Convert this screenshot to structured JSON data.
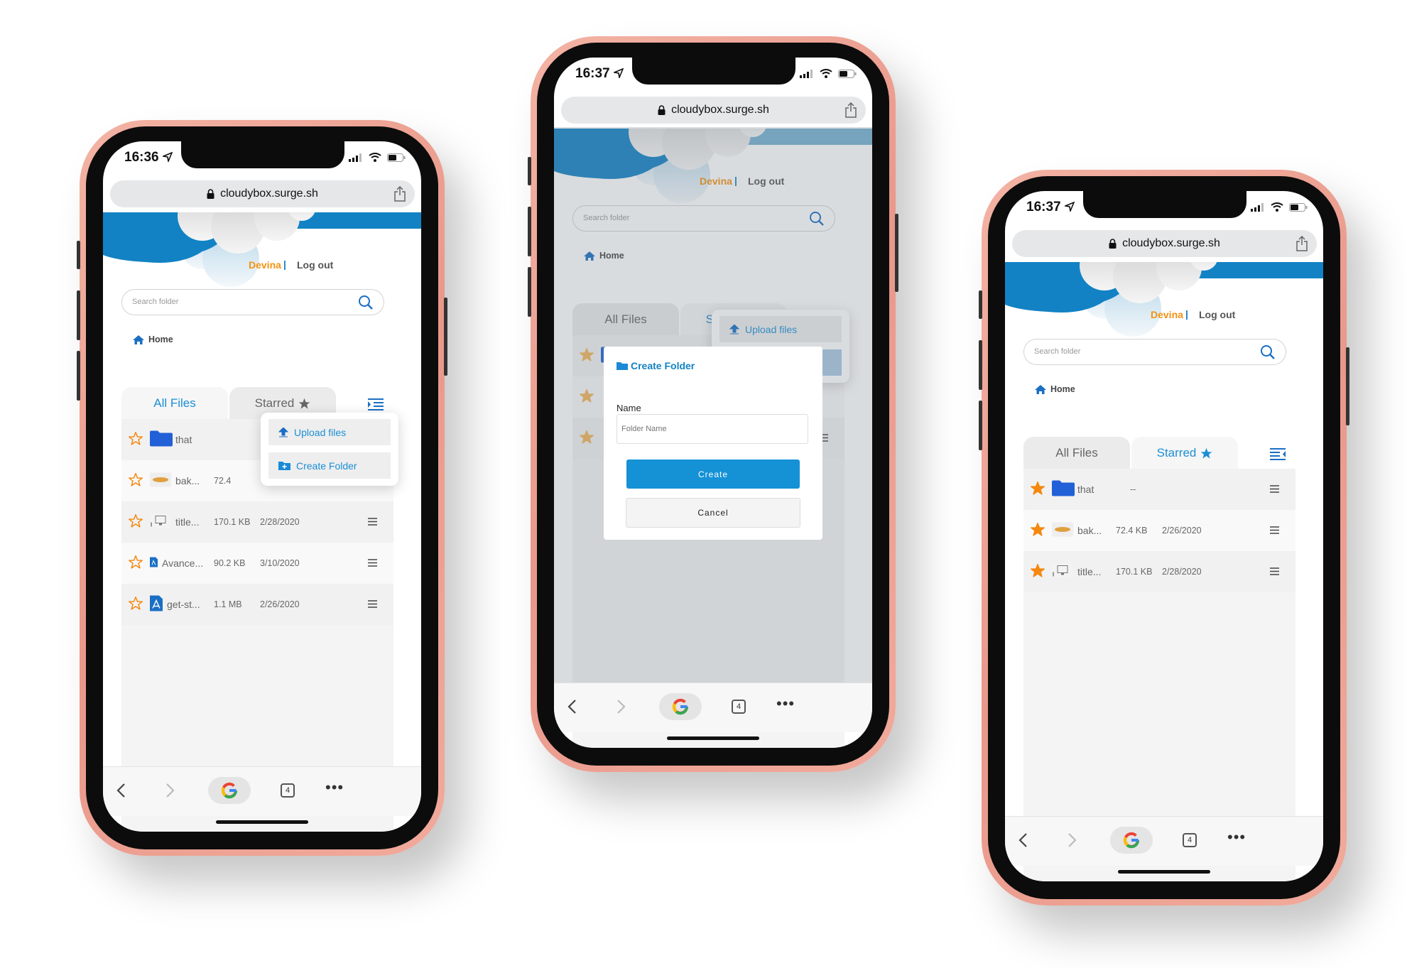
{
  "colors": {
    "brand_blue": "#1282c4",
    "accent_orange": "#f39212",
    "tab_active": "#1b8fd6",
    "folder": "#2160d6",
    "phone_rim": "#ee9f91"
  },
  "phones": [
    {
      "status_time": "16:36",
      "url": "cloudybox.surge.sh",
      "user": "Devina",
      "separator": "|",
      "logout": "Log out",
      "search_placeholder": "Search folder",
      "breadcrumb": "Home",
      "tabs": [
        {
          "label": "All Files",
          "active": true,
          "icon": "star-icon"
        },
        {
          "label": "Starred",
          "active": false,
          "icon": "star-icon"
        }
      ],
      "rows": [
        {
          "starred": false,
          "icon": "folder-icon",
          "name": "that",
          "size": "",
          "date": ""
        },
        {
          "starred": false,
          "icon": "image-thumbnail",
          "name": "bak...",
          "size": "72.4",
          "date": ""
        },
        {
          "starred": false,
          "icon": "computer-thumbnail",
          "name": "title...",
          "size": "170.1 KB",
          "date": "2/28/2020"
        },
        {
          "starred": false,
          "icon": "pdf-small-icon",
          "name": "Avance...",
          "size": "90.2 KB",
          "date": "3/10/2020"
        },
        {
          "starred": false,
          "icon": "pdf-icon",
          "name": "get-st...",
          "size": "1.1 MB",
          "date": "2/26/2020"
        }
      ],
      "dropdown": {
        "upload": "Upload files",
        "create": "Create Folder"
      },
      "toolbar": {
        "tab_count": "4"
      }
    },
    {
      "status_time": "16:37",
      "url": "cloudybox.surge.sh",
      "user": "Devina",
      "separator": "|",
      "logout": "Log out",
      "search_placeholder": "Search folder",
      "breadcrumb": "Home",
      "tabs": [
        {
          "label": "All Files",
          "active": false,
          "icon": "star-icon"
        },
        {
          "label": "Starred",
          "active": true,
          "icon": "star-icon"
        }
      ],
      "rows": [
        {
          "starred": true,
          "icon": "folder-icon",
          "name": "",
          "size": "",
          "date": ""
        },
        {
          "starred": true,
          "icon": "",
          "name": "",
          "size": "",
          "date": ""
        },
        {
          "starred": true,
          "icon": "",
          "name": "",
          "size": "",
          "date": ""
        }
      ],
      "dropdown": {
        "upload": "Upload files",
        "create": ""
      },
      "modal": {
        "title": "Create Folder",
        "name_label": "Name",
        "name_placeholder": "Folder Name",
        "create": "Create",
        "cancel": "Cancel"
      },
      "toolbar": {
        "tab_count": "4"
      }
    },
    {
      "status_time": "16:37",
      "url": "cloudybox.surge.sh",
      "user": "Devina",
      "separator": "|",
      "logout": "Log out",
      "search_placeholder": "Search folder",
      "breadcrumb": "Home",
      "tabs": [
        {
          "label": "All Files",
          "active": false,
          "icon": "star-icon"
        },
        {
          "label": "Starred",
          "active": true,
          "icon": "star-icon"
        }
      ],
      "rows": [
        {
          "starred": true,
          "icon": "folder-icon",
          "name": "that",
          "size": "--",
          "date": ""
        },
        {
          "starred": true,
          "icon": "image-thumbnail",
          "name": "bak...",
          "size": "72.4 KB",
          "date": "2/26/2020"
        },
        {
          "starred": true,
          "icon": "computer-thumbnail",
          "name": "title...",
          "size": "170.1 KB",
          "date": "2/28/2020"
        }
      ],
      "toolbar": {
        "tab_count": "4"
      }
    }
  ]
}
